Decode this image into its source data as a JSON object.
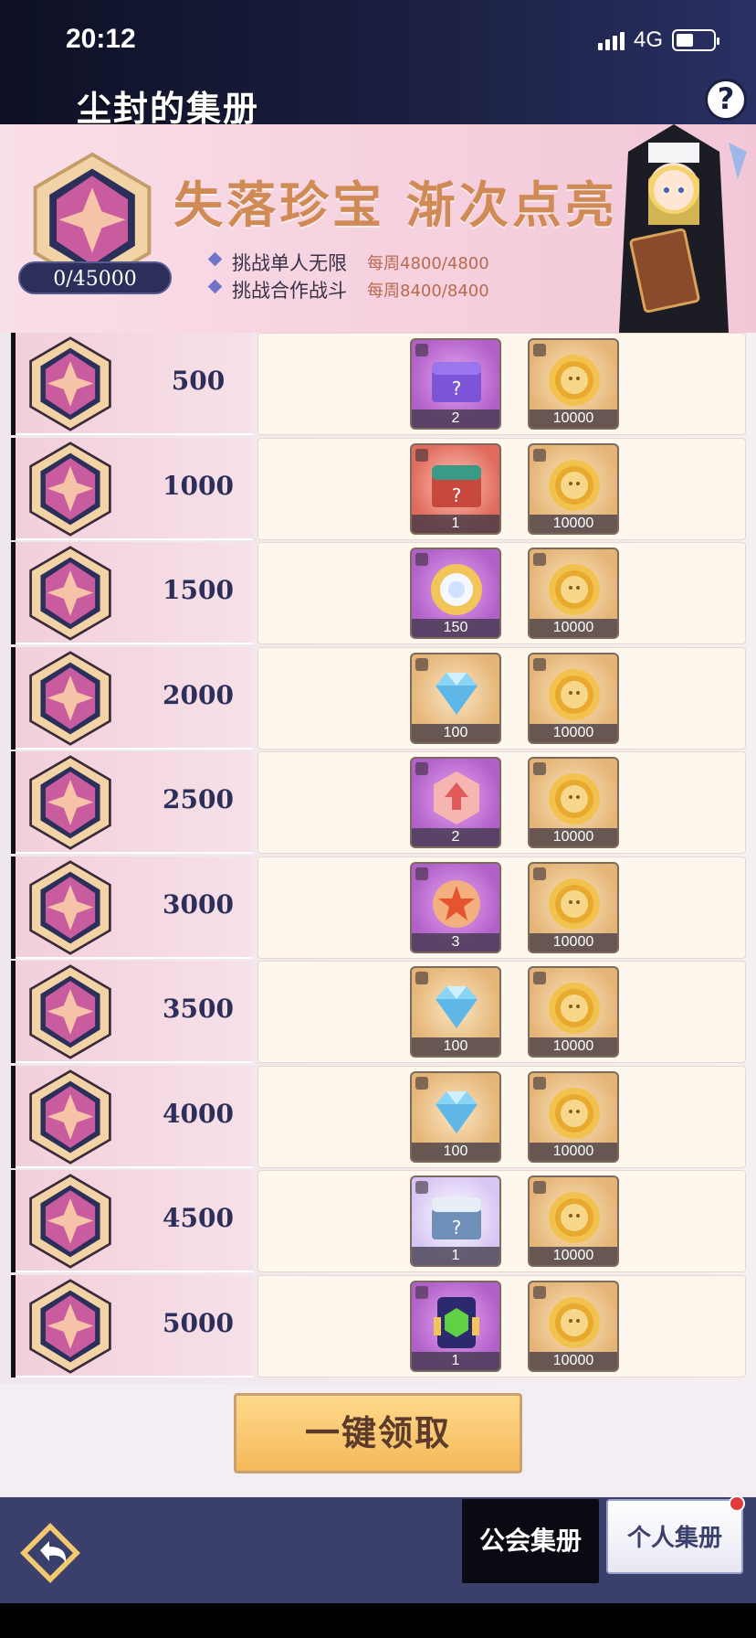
{
  "status": {
    "time": "20:12",
    "network": "4G"
  },
  "header": {
    "title": "尘封的集册",
    "help_icon": "question-icon"
  },
  "banner": {
    "progress": "0/45000",
    "slogan": "失落珍宝 渐次点亮",
    "lines": [
      {
        "label": "挑战单人无限",
        "quota": "每周4800/4800"
      },
      {
        "label": "挑战合作战斗",
        "quota": "每周8400/8400"
      }
    ]
  },
  "colors": {
    "accent": "#cf8a55",
    "nav": "#3b3f6b",
    "claim": "#f4b95a"
  },
  "milestones": [
    {
      "points": "500",
      "rewards": [
        {
          "icon": "purple-mystery-chest-icon",
          "tone": "purple",
          "qty": "2"
        },
        {
          "icon": "gold-coin-icon",
          "tone": "gold",
          "qty": "10000"
        }
      ]
    },
    {
      "points": "1000",
      "rewards": [
        {
          "icon": "red-mystery-chest-icon",
          "tone": "red",
          "qty": "1"
        },
        {
          "icon": "gold-coin-icon",
          "tone": "gold",
          "qty": "10000"
        }
      ]
    },
    {
      "points": "1500",
      "rewards": [
        {
          "icon": "orb-icon",
          "tone": "purple",
          "qty": "150"
        },
        {
          "icon": "gold-coin-icon",
          "tone": "gold",
          "qty": "10000"
        }
      ]
    },
    {
      "points": "2000",
      "rewards": [
        {
          "icon": "diamond-icon",
          "tone": "gold",
          "qty": "100"
        },
        {
          "icon": "gold-coin-icon",
          "tone": "gold",
          "qty": "10000"
        }
      ]
    },
    {
      "points": "2500",
      "rewards": [
        {
          "icon": "upgrade-badge-icon",
          "tone": "purple",
          "qty": "2"
        },
        {
          "icon": "gold-coin-icon",
          "tone": "gold",
          "qty": "10000"
        }
      ]
    },
    {
      "points": "3000",
      "rewards": [
        {
          "icon": "star-medal-icon",
          "tone": "purple",
          "qty": "3"
        },
        {
          "icon": "gold-coin-icon",
          "tone": "gold",
          "qty": "10000"
        }
      ]
    },
    {
      "points": "3500",
      "rewards": [
        {
          "icon": "diamond-icon",
          "tone": "gold",
          "qty": "100"
        },
        {
          "icon": "gold-coin-icon",
          "tone": "gold",
          "qty": "10000"
        }
      ]
    },
    {
      "points": "4000",
      "rewards": [
        {
          "icon": "diamond-icon",
          "tone": "gold",
          "qty": "100"
        },
        {
          "icon": "gold-coin-icon",
          "tone": "gold",
          "qty": "10000"
        }
      ]
    },
    {
      "points": "4500",
      "rewards": [
        {
          "icon": "white-mystery-chest-icon",
          "tone": "white",
          "qty": "1"
        },
        {
          "icon": "gold-coin-icon",
          "tone": "gold",
          "qty": "10000"
        }
      ]
    },
    {
      "points": "5000",
      "rewards": [
        {
          "icon": "green-gem-frame-icon",
          "tone": "purple",
          "qty": "1"
        },
        {
          "icon": "gold-coin-icon",
          "tone": "gold",
          "qty": "10000"
        }
      ]
    }
  ],
  "claim_button": "一键领取",
  "tabs": {
    "guild": "公会集册",
    "personal": "个人集册"
  }
}
